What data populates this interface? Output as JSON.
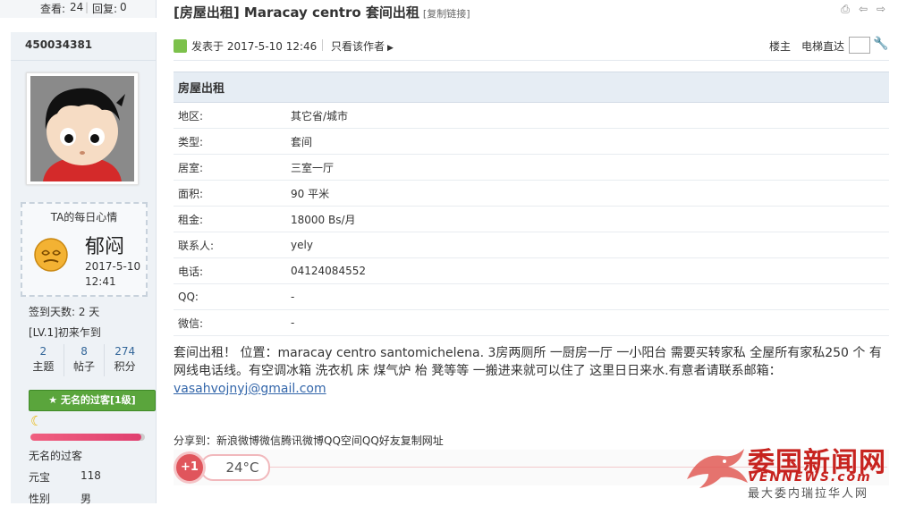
{
  "topbar": {
    "views_label": "查看:",
    "views": "24",
    "replies_label": "回复:",
    "replies": "0",
    "title": "[房屋出租] Maracay centro 套间出租",
    "copy_link": "[复制链接]"
  },
  "sidebar": {
    "username": "450034381",
    "mood_header": "TA的每日心情",
    "mood_name": "郁闷",
    "mood_date": "2017-5-10",
    "mood_time": "12:41",
    "checkin": "签到天数: 2 天",
    "level": "[LV.1]初来乍到",
    "stats": [
      {
        "value": "2",
        "label": "主题"
      },
      {
        "value": "8",
        "label": "帖子"
      },
      {
        "value": "274",
        "label": "积分"
      }
    ],
    "group_badge": "无名的过客[1级]",
    "level_progress": 0.97,
    "group_name": "无名的过客",
    "fields": [
      {
        "key": "元宝",
        "value": "118"
      },
      {
        "key": "性别",
        "value": "男"
      }
    ]
  },
  "post": {
    "posted": "发表于 2017-5-10 12:46",
    "only_author": "只看该作者",
    "floor": "楼主",
    "elevator": "电梯直达",
    "table_title": "房屋出租",
    "rows": [
      {
        "key": "地区:",
        "value": "其它省/城市"
      },
      {
        "key": "类型:",
        "value": "套间"
      },
      {
        "key": "居室:",
        "value": "三室一厅"
      },
      {
        "key": "面积:",
        "value": "90 平米"
      },
      {
        "key": "租金:",
        "value": "18000 Bs/月"
      },
      {
        "key": "联系人:",
        "value": "yely"
      },
      {
        "key": "电话:",
        "value": "04124084552"
      },
      {
        "key": "QQ:",
        "value": "-"
      },
      {
        "key": "微信:",
        "value": "-"
      }
    ],
    "body_line1": "套间出租！ 位置：maracay centro santomichelena.   3房两厕所 一厨房一厅 一小阳台      需要买转家私  全屋所有家私250 个   有网线电话线。有空调冰箱 洗衣机 床 煤气炉 枱 凳等等    一搬进来就可以住了 这里日日来水.有意者请联系邮箱：",
    "email": "vasahvojnyj@gmail.com",
    "share": "分享到：新浪微博微信腾讯微博QQ空间QQ好友复制网址",
    "plus_one": "+1",
    "temperature": "24°C"
  },
  "watermark": {
    "title": "委国新闻网",
    "url": "VENNEWS.com",
    "sub": "最大委内瑞拉华人网"
  },
  "colors": {
    "accent": "#336699",
    "badge_green": "#5aa53c",
    "watermark_red": "#c7231f"
  }
}
